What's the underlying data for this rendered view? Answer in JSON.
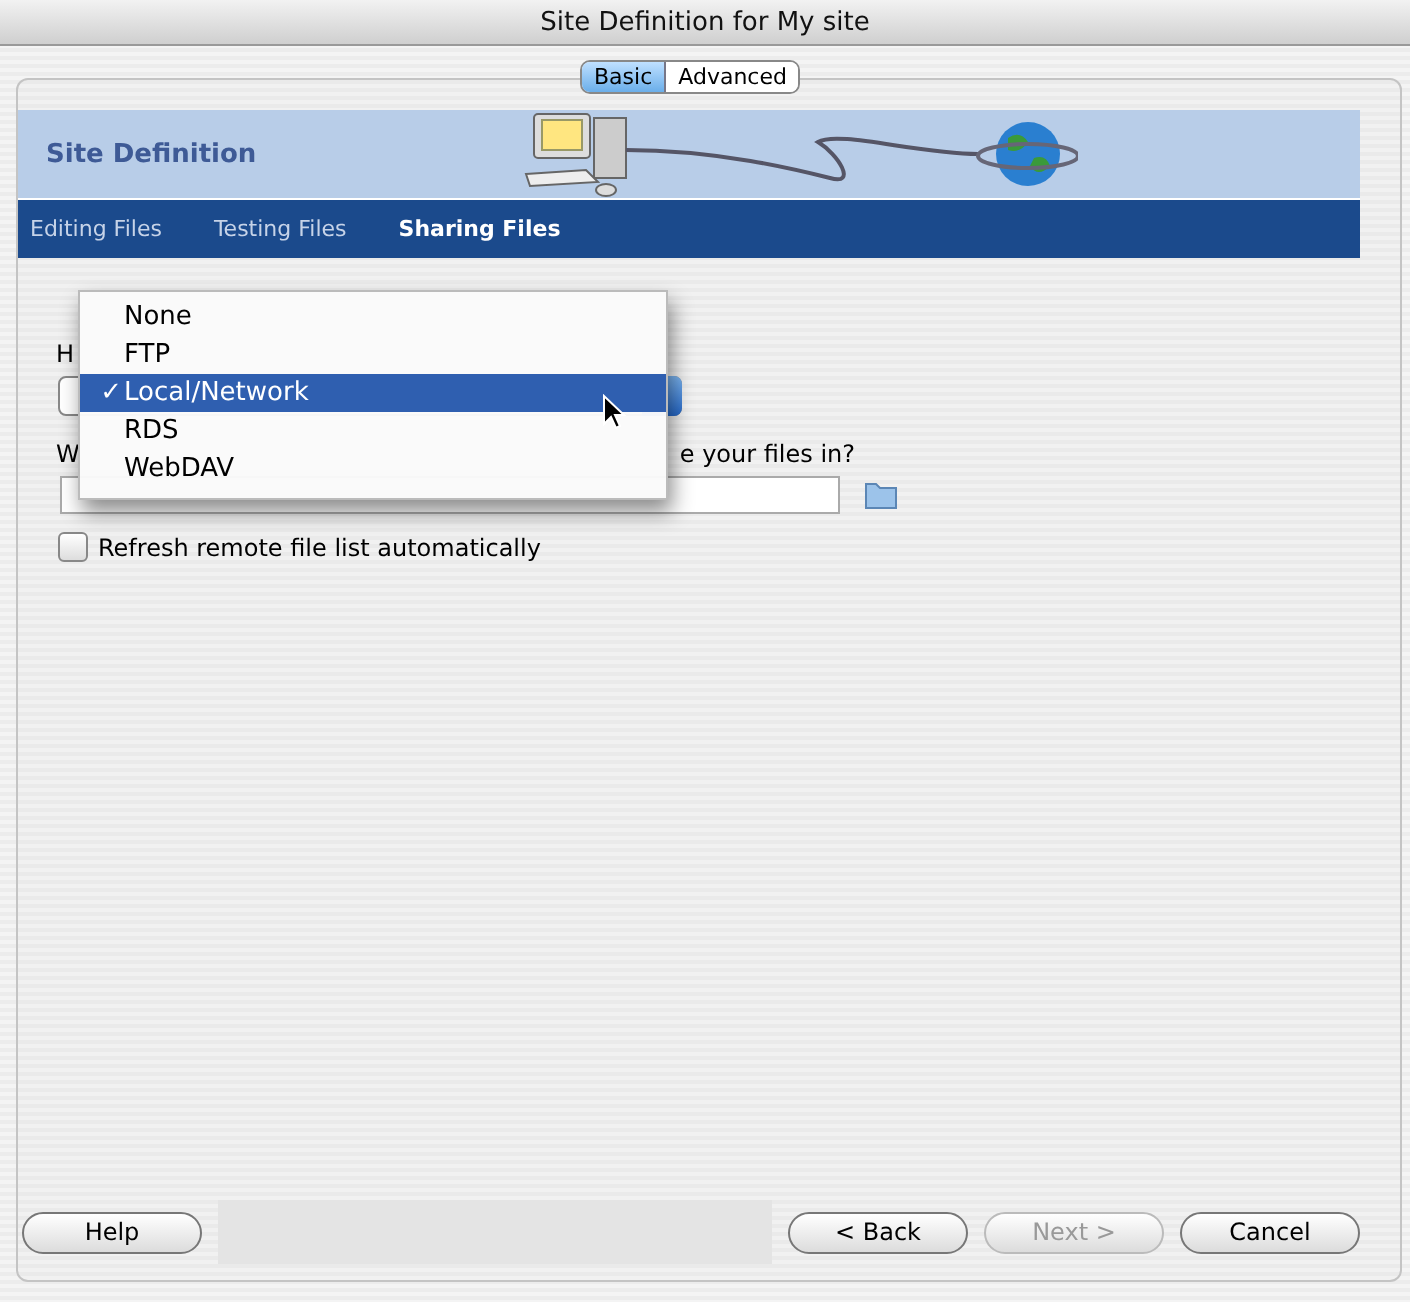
{
  "window": {
    "title": "Site Definition for My site"
  },
  "tabs": [
    {
      "label": "Basic",
      "selected": true
    },
    {
      "label": "Advanced",
      "selected": false
    }
  ],
  "header": {
    "title": "Site Definition"
  },
  "nav": [
    {
      "label": "Editing Files",
      "selected": false
    },
    {
      "label": "Testing Files",
      "selected": false
    },
    {
      "label": "Sharing Files",
      "selected": true
    }
  ],
  "question_1": {
    "visible_start": "H"
  },
  "question_2": {
    "visible_start": "W",
    "visible_end": "e your files in?"
  },
  "refresh_checkbox": {
    "label": "Refresh remote file list automatically",
    "checked": false
  },
  "menu": {
    "items": [
      {
        "label": "None",
        "selected": false
      },
      {
        "label": "FTP",
        "selected": false
      },
      {
        "label": "Local/Network",
        "selected": true
      },
      {
        "label": "RDS",
        "selected": false
      },
      {
        "label": "WebDAV",
        "selected": false
      }
    ],
    "check_mark": "✓"
  },
  "buttons": [
    {
      "label": "Help",
      "disabled": false
    },
    {
      "label": "< Back",
      "disabled": false
    },
    {
      "label": "Next >",
      "disabled": true
    },
    {
      "label": "Cancel",
      "disabled": false
    }
  ]
}
